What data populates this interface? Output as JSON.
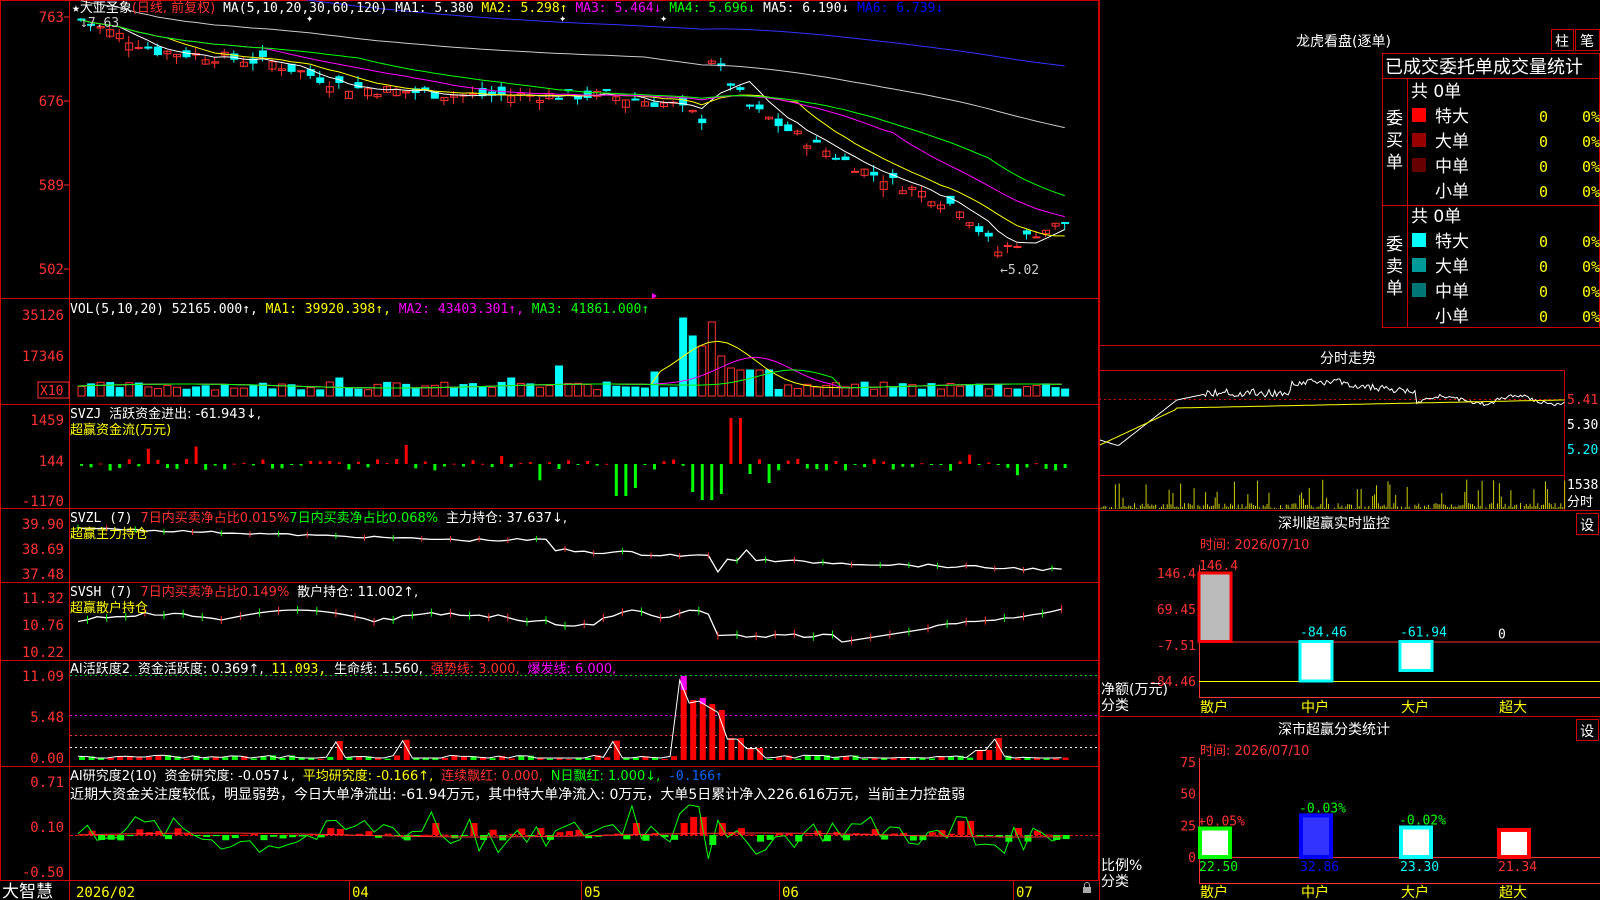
{
  "stock": {
    "name": "大亚圣象",
    "period": "(日线, 前复权)",
    "ma_params": "MA(5,10,20,30,60,120)",
    "ma_items": [
      {
        "label": "MA1:",
        "value": "5.380",
        "arrow": "",
        "color": "#ffffff"
      },
      {
        "label": "MA2:",
        "value": "5.298",
        "arrow": "↑",
        "color": "#ffff00"
      },
      {
        "label": "MA3:",
        "value": "5.464",
        "arrow": "↓",
        "color": "#ff00ff"
      },
      {
        "label": "MA4:",
        "value": "5.696",
        "arrow": "↓",
        "color": "#00ff00"
      },
      {
        "label": "MA5:",
        "value": "6.190",
        "arrow": "↓",
        "color": "#ffffff"
      },
      {
        "label": "MA6:",
        "value": "6.739",
        "arrow": "↓",
        "color": "#0000ff"
      }
    ],
    "high_marker": "7.63",
    "low_marker": "←5.02"
  },
  "axes": {
    "price_ticks": [
      "763",
      "676",
      "589",
      "502"
    ],
    "vol_ticks": [
      "35126",
      "17346"
    ],
    "vol_unit": "X10",
    "svzj_ticks": [
      "1459",
      "144",
      "-1170"
    ],
    "svzl_ticks": [
      "39.90",
      "38.69",
      "37.48"
    ],
    "svsh_ticks": [
      "11.32",
      "10.76",
      "10.22"
    ],
    "ai_ticks": [
      "11.09",
      "5.48",
      "0.00"
    ],
    "research_ticks": [
      "0.71",
      "0.10",
      "-0.50"
    ],
    "dates": [
      "2026/02",
      "04",
      "05",
      "06",
      "07"
    ]
  },
  "panels": {
    "vol": {
      "label": "VOL(5,10,20)",
      "value": "52165.000↑,",
      "ma1": "MA1: 39920.398↑,",
      "ma2": "MA2: 43403.301↑,",
      "ma3": "MA3: 41861.000↑"
    },
    "svzj": {
      "label": "SVZJ",
      "desc": "活跃资金进出: -61.943↓,",
      "sub": "超赢资金流(万元)"
    },
    "svzl": {
      "label": "SVZL (7)",
      "p1": "7日内买卖净占比0.015%",
      "p2": "7日内买卖净占比0.068%",
      "p3": "主力持仓: 37.637↓,",
      "sub": "超赢主力持仓"
    },
    "svsh": {
      "label": "SVSH (7)",
      "p1": "7日内买卖净占比0.149%",
      "p2": "散户持仓: 11.002↑,",
      "sub": "超赢散户持仓"
    },
    "ai": {
      "label": "AI活跃度2",
      "p1": "资金活跃度: 0.369↑,",
      "p2": "11.093,",
      "p3": "生命线: 1.560,",
      "p4": "强势线: 3.000,",
      "p5": "爆发线: 6.000,"
    },
    "research": {
      "label": "AI研究度2(10)",
      "p1": "资金研究度: -0.057↓,",
      "p2": "平均研究度: -0.166↑,",
      "p3": "连续飘红: 0.000,",
      "p4": "N日飘红: 1.000↓,",
      "p5": "-0.166↑",
      "summary": "近期大资金关注度较低，明显弱势，今日大单净流出: -61.94万元，其中特大单净流入: 0万元，大单5日累计净入226.616万元，当前主力控盘弱"
    }
  },
  "brand": "大智慧",
  "right": {
    "dragon": {
      "title": "龙虎看盘(逐单)",
      "tabs": [
        "柱",
        "笔"
      ],
      "header": "已成交委托单成交量统计",
      "buy": {
        "label": "委买单",
        "total": "共 0单",
        "rows": [
          {
            "name": "特大",
            "count": "0",
            "pct": "0%",
            "color": "#ff0000"
          },
          {
            "name": "大单",
            "count": "0",
            "pct": "0%",
            "color": "#990000"
          },
          {
            "name": "中单",
            "count": "0",
            "pct": "0%",
            "color": "#660000"
          },
          {
            "name": "小单",
            "count": "0",
            "pct": "0%",
            "color": "#000000"
          }
        ]
      },
      "sell": {
        "label": "委卖单",
        "total": "共 0单",
        "rows": [
          {
            "name": "特大",
            "count": "0",
            "pct": "0%",
            "color": "#00ffff"
          },
          {
            "name": "大单",
            "count": "0",
            "pct": "0%",
            "color": "#009999"
          },
          {
            "name": "中单",
            "count": "0",
            "pct": "0%",
            "color": "#007777"
          },
          {
            "name": "小单",
            "count": "0",
            "pct": "0%",
            "color": "#000000"
          }
        ]
      }
    },
    "intraday": {
      "title": "分时走势",
      "price_ticks": [
        "5.41",
        "5.30",
        "5.20"
      ],
      "vol_tick": "1538",
      "vol_unit": "分时"
    },
    "sz_monitor": {
      "title": "深圳超赢实时监控",
      "settings": "设",
      "time": "时间: 2026/07/10",
      "yticks": [
        "146.4",
        "69.45",
        "-7.51",
        "-84.46"
      ],
      "ylabel": "净额(万元)",
      "xlabel": "分类",
      "categories": [
        "散户",
        "中户",
        "大户",
        "超大"
      ],
      "values": [
        146.4,
        -84.46,
        -61.94,
        0
      ],
      "value_labels": [
        "146.4",
        "-84.46",
        "-61.94",
        "0"
      ]
    },
    "sz_class": {
      "title": "深市超赢分类统计",
      "settings": "设",
      "time": "时间: 2026/07/10",
      "yticks": [
        "75",
        "50",
        "25",
        "0"
      ],
      "ylabel": "比例%",
      "xlabel": "分类",
      "categories": [
        "散户",
        "中户",
        "大户",
        "超大"
      ],
      "values": [
        22.5,
        32.86,
        23.3,
        21.34
      ],
      "value_labels": [
        "22.50",
        "32.86",
        "23.30",
        "21.34"
      ],
      "changes": [
        "+0.05%",
        "-0.03%",
        "-0.02%",
        ""
      ]
    }
  },
  "chart_data": [
    {
      "type": "bar",
      "title": "深圳超赢实时监控",
      "ylabel": "净额(万元)",
      "xlabel": "分类",
      "categories": [
        "散户",
        "中户",
        "大户",
        "超大"
      ],
      "values": [
        146.4,
        -84.46,
        -61.94,
        0
      ],
      "ylim": [
        -84.46,
        146.4
      ]
    },
    {
      "type": "bar",
      "title": "深市超赢分类统计",
      "ylabel": "比例%",
      "xlabel": "分类",
      "categories": [
        "散户",
        "中户",
        "大户",
        "超大"
      ],
      "values": [
        22.5,
        32.86,
        23.3,
        21.34
      ],
      "ylim": [
        0,
        75
      ]
    }
  ]
}
